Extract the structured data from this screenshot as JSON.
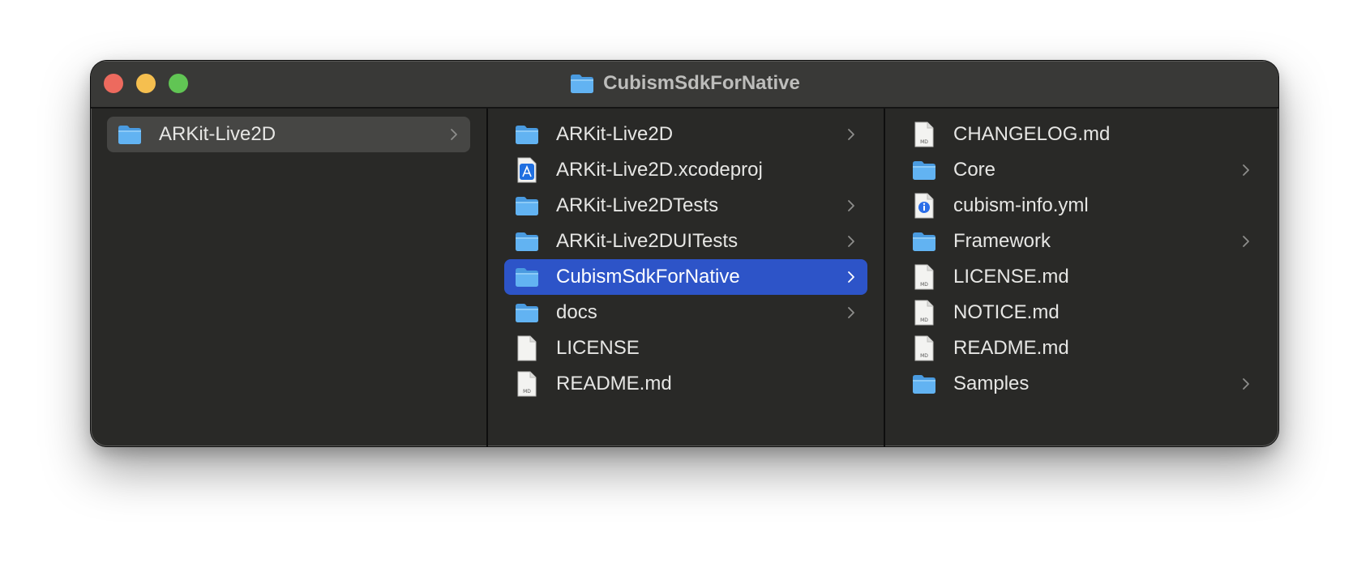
{
  "window": {
    "title": "CubismSdkForNative",
    "title_icon": "folder-icon"
  },
  "columns": [
    {
      "items": [
        {
          "label": "ARKit-Live2D",
          "icon": "folder-icon",
          "has_children": true,
          "selected": "inactive"
        }
      ]
    },
    {
      "items": [
        {
          "label": "ARKit-Live2D",
          "icon": "folder-icon",
          "has_children": true
        },
        {
          "label": "ARKit-Live2D.xcodeproj",
          "icon": "xcodeproj-icon",
          "has_children": false
        },
        {
          "label": "ARKit-Live2DTests",
          "icon": "folder-icon",
          "has_children": true
        },
        {
          "label": "ARKit-Live2DUITests",
          "icon": "folder-icon",
          "has_children": true
        },
        {
          "label": "CubismSdkForNative",
          "icon": "folder-icon",
          "has_children": true,
          "selected": "active"
        },
        {
          "label": "docs",
          "icon": "folder-icon",
          "has_children": true
        },
        {
          "label": "LICENSE",
          "icon": "blank-document-icon",
          "has_children": false
        },
        {
          "label": "README.md",
          "icon": "markdown-document-icon",
          "has_children": false
        }
      ]
    },
    {
      "items": [
        {
          "label": "CHANGELOG.md",
          "icon": "markdown-document-icon",
          "has_children": false
        },
        {
          "label": "Core",
          "icon": "folder-icon",
          "has_children": true
        },
        {
          "label": "cubism-info.yml",
          "icon": "info-document-icon",
          "has_children": false
        },
        {
          "label": "Framework",
          "icon": "folder-icon",
          "has_children": true
        },
        {
          "label": "LICENSE.md",
          "icon": "markdown-document-icon",
          "has_children": false
        },
        {
          "label": "NOTICE.md",
          "icon": "markdown-document-icon",
          "has_children": false
        },
        {
          "label": "README.md",
          "icon": "markdown-document-icon",
          "has_children": false
        },
        {
          "label": "Samples",
          "icon": "folder-icon",
          "has_children": true
        }
      ]
    }
  ],
  "doc_badge": "MD",
  "colors": {
    "selection_active": "#2d54c8",
    "selection_inactive": "#464644",
    "folder": "#5aaeee",
    "window_bg": "#292927"
  }
}
